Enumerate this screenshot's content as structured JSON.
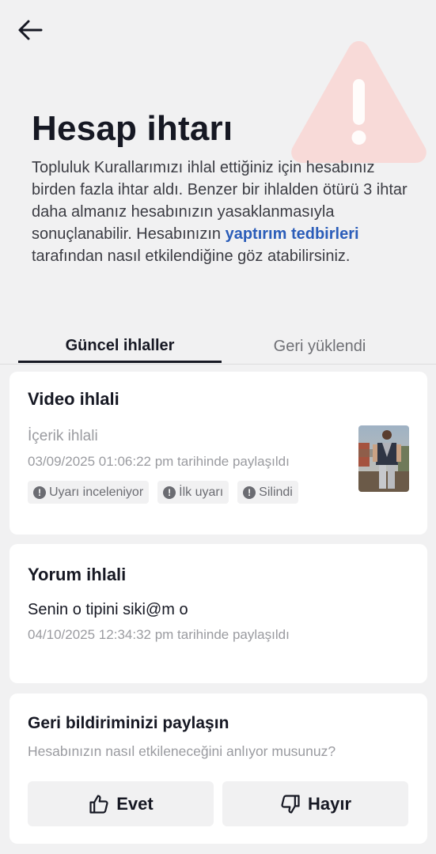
{
  "header": {
    "back_icon": "arrow-left-icon",
    "warning_icon": "warning-triangle-icon"
  },
  "title": "Hesap ihtarı",
  "description": {
    "text_before_link": "Topluluk Kurallarımızı ihlal ettiğiniz için hesabınız birden fazla ihtar aldı. Benzer bir ihlalden ötürü 3 ihtar daha almanız hesabınızın yasaklanmasıyla sonuçlanabilir. Hesabınızın ",
    "link_text": "yaptırım tedbirleri",
    "text_after_link": " tarafından nasıl etkilendiğine göz atabilirsiniz."
  },
  "tabs": [
    {
      "label": "Güncel ihlaller",
      "active": true
    },
    {
      "label": "Geri yüklendi",
      "active": false
    }
  ],
  "violations": {
    "video": {
      "title": "Video ihlali",
      "type": "İçerik ihlali",
      "date": "03/09/2025 01:06:22 pm tarihinde paylaşıldı",
      "badges": [
        {
          "label": "Uyarı inceleniyor",
          "icon": "exclamation-circle-icon"
        },
        {
          "label": "İlk uyarı",
          "icon": "exclamation-circle-icon"
        },
        {
          "label": "Silindi",
          "icon": "exclamation-circle-icon"
        }
      ]
    },
    "comment": {
      "title": "Yorum ihlali",
      "text": "Senin o tipini siki@m o",
      "date": "04/10/2025 12:34:32 pm tarihinde paylaşıldı"
    }
  },
  "feedback": {
    "title": "Geri bildiriminizi paylaşın",
    "question": "Hesabınızın nasıl etkileneceğini anlıyor musunuz?",
    "yes_label": "Evet",
    "no_label": "Hayır",
    "yes_icon": "thumbs-up-icon",
    "no_icon": "thumbs-down-icon"
  },
  "colors": {
    "background": "#f1f1f2",
    "link": "#2b5db9",
    "warning_tint": "#f9d6d4",
    "text_primary": "#161823",
    "text_secondary": "#9a9ba0"
  }
}
